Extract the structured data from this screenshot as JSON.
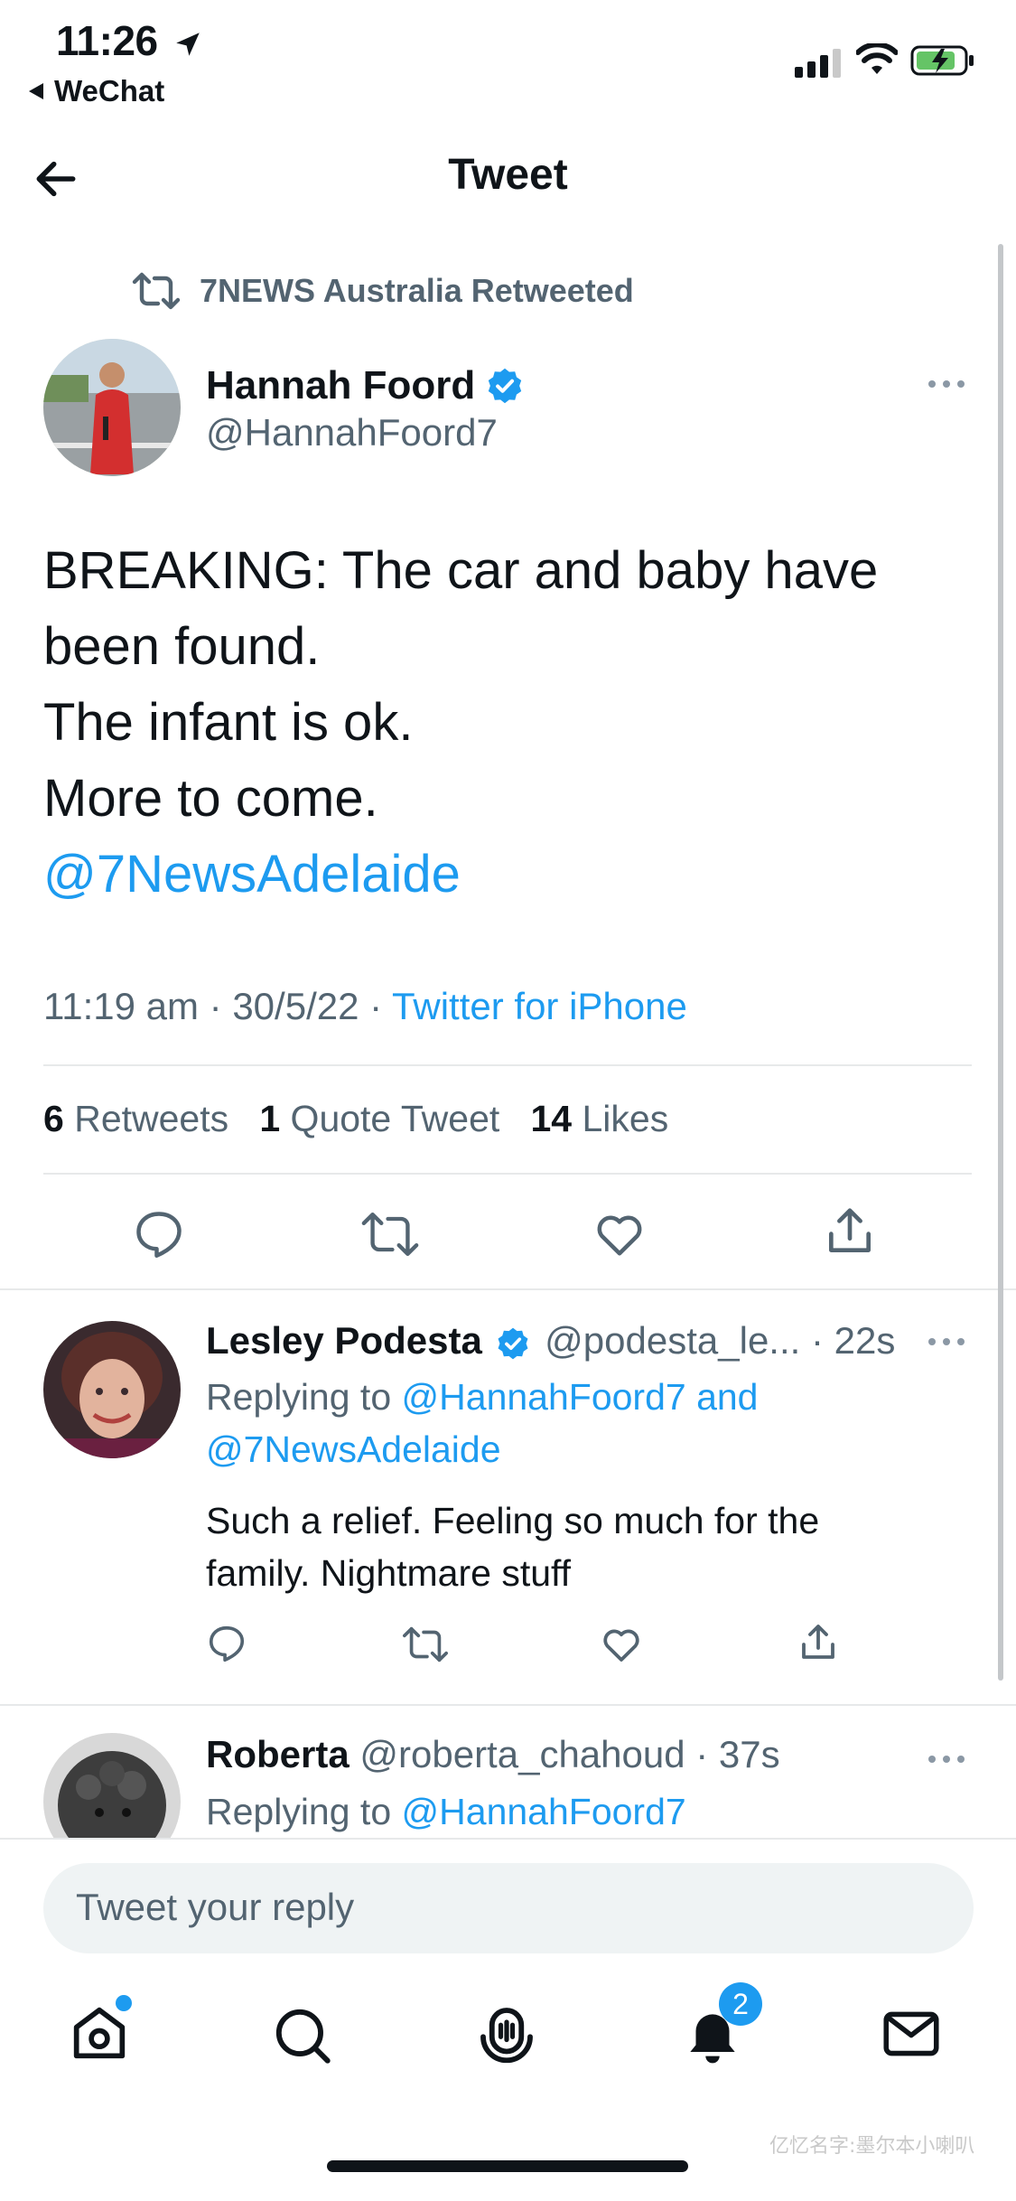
{
  "status_bar": {
    "time": "11:26",
    "back_app": "WeChat"
  },
  "header": {
    "title": "Tweet"
  },
  "retweet_banner": {
    "text": "7NEWS Australia Retweeted"
  },
  "main_tweet": {
    "author_name": "Hannah Foord",
    "author_handle": "@HannahFoord7",
    "text_lines": [
      "BREAKING: The car and baby have",
      "been found.",
      "The infant is ok.",
      "More to come."
    ],
    "mention": "@7NewsAdelaide",
    "time": "11:19 am",
    "date": "30/5/22",
    "source": "Twitter for iPhone",
    "retweets_count": "6",
    "retweets_label": "Retweets",
    "quotes_count": "1",
    "quotes_label": "Quote Tweet",
    "likes_count": "14",
    "likes_label": "Likes"
  },
  "replies": [
    {
      "author_name": "Lesley Podesta",
      "author_handle": "@podesta_le...",
      "time": "· 22s",
      "replying_prefix": "Replying to",
      "replying_to_line1": "@HannahFoord7 and",
      "replying_to_line2": "@7NewsAdelaide",
      "text_line1": "Such a relief. Feeling so much for the",
      "text_line2": "family. Nightmare stuff"
    },
    {
      "author_name": "Roberta",
      "author_handle": "@roberta_chahoud",
      "time": "· 37s",
      "replying_prefix": "Replying to",
      "replying_to_line1": "@HannahFoord7"
    }
  ],
  "reply_box": {
    "placeholder": "Tweet your reply"
  },
  "tab_bar": {
    "notifications_badge": "2"
  },
  "watermark": {
    "text": "亿忆名字:墨尔本小喇叭"
  },
  "colors": {
    "link": "#1d9bf0",
    "text": "#0f1419",
    "muted": "#536471",
    "verified": "#1d9bf0",
    "battery": "#65c466"
  }
}
